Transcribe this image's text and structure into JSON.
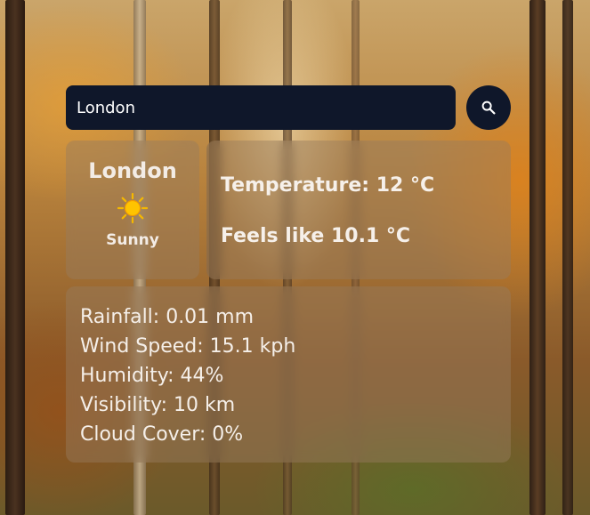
{
  "search": {
    "value": "London",
    "placeholder": ""
  },
  "search_button": {
    "icon": "search-icon"
  },
  "location": {
    "city": "London",
    "condition_icon": "sun-icon",
    "condition": "Sunny"
  },
  "temperature": {
    "temperature_text": "Temperature: 12 °C",
    "feels_like_text": "Feels like 10.1 °C"
  },
  "details": {
    "rainfall": "Rainfall: 0.01 mm",
    "wind_speed": "Wind Speed: 15.1 kph",
    "humidity": "Humidity: 44%",
    "visibility": "Visibility: 10 km",
    "cloud_cover": "Cloud Cover: 0%"
  },
  "colors": {
    "search_bg": "#0f172a",
    "card_bg": "rgba(150,125,95,0.45)",
    "sun": "#f5b800"
  }
}
